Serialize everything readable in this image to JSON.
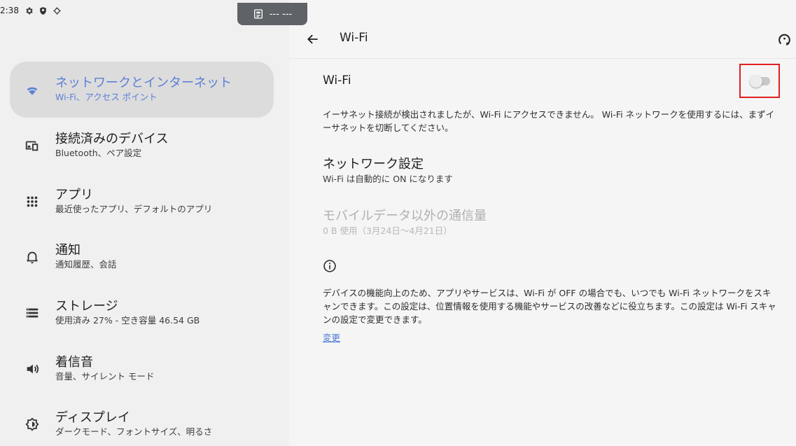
{
  "status_bar": {
    "time": "2:38",
    "icons": [
      "settings-icon",
      "shield-icon",
      "bug-icon"
    ]
  },
  "cast_indicator": {
    "text": "--- ---",
    "icon": "cast-icon"
  },
  "sidebar": {
    "items": [
      {
        "title": "ネットワークとインターネット",
        "subtitle": "Wi-Fi、アクセス ポイント",
        "icon": "wifi-icon",
        "selected": true
      },
      {
        "title": "接続済みのデバイス",
        "subtitle": "Bluetooth、ペア設定",
        "icon": "devices-icon"
      },
      {
        "title": "アプリ",
        "subtitle": "最近使ったアプリ、デフォルトのアプリ",
        "icon": "apps-grid-icon"
      },
      {
        "title": "通知",
        "subtitle": "通知履歴、会話",
        "icon": "bell-icon"
      },
      {
        "title": "ストレージ",
        "subtitle": "使用済み 27% - 空き容量 46.54 GB",
        "icon": "storage-icon"
      },
      {
        "title": "着信音",
        "subtitle": "音量、サイレント モード",
        "icon": "volume-icon"
      },
      {
        "title": "ディスプレイ",
        "subtitle": "ダークモード、フォントサイズ、明るさ",
        "icon": "brightness-icon"
      }
    ]
  },
  "header": {
    "title": "Wi-Fi",
    "back_icon": "arrow-back-icon",
    "help_icon": "help-feedback-icon"
  },
  "wifi": {
    "label": "Wi-Fi",
    "toggle_on": false,
    "notice": "イーサネット接続が検出されましたが、Wi-Fi にアクセスできません。 Wi-Fi ネットワークを使用するには、まずイーサネットを切断してください。"
  },
  "network_settings": {
    "title": "ネットワーク設定",
    "subtitle": "Wi-Fi は自動的に ON になります"
  },
  "data_usage": {
    "title": "モバイルデータ以外の通信量",
    "subtitle": "0 B 使用（3月24日～4月21日）",
    "disabled": true
  },
  "scan_info": {
    "icon": "info-icon",
    "text": "デバイスの機能向上のため、アプリやサービスは、Wi-Fi が OFF の場合でも、いつでも Wi-Fi ネットワークをスキャンできます。この設定は、位置情報を使用する機能やサービスの改善などに役立ちます。この設定は Wi-Fi スキャンの設定で変更できます。",
    "link": "変更"
  },
  "colors": {
    "accent": "#5b7fd8",
    "link": "#4a78d4",
    "highlight_border": "#e11e1e",
    "sidebar_bg": "#f0f0f0",
    "selected_bg": "#dcdcdc"
  }
}
